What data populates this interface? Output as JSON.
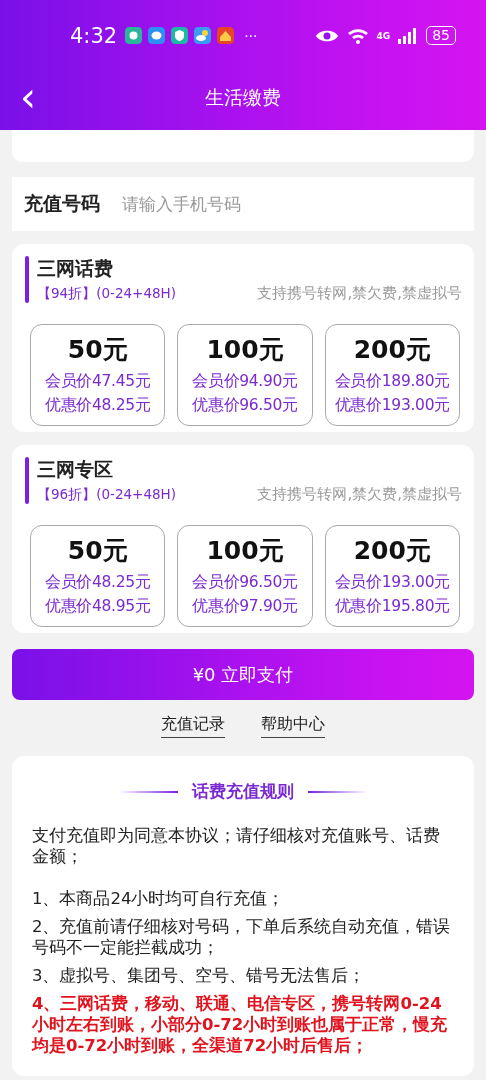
{
  "status_bar": {
    "time": "4:32",
    "more": "···",
    "network": "4G",
    "battery": "85"
  },
  "nav": {
    "back": "‹",
    "title": "生活缴费"
  },
  "phone": {
    "label": "充值号码",
    "placeholder": "请输入手机号码"
  },
  "plans": [
    {
      "title": "三网话费",
      "discount": "【94折】(0-24+48H)",
      "note": "支持携号转网,禁欠费,禁虚拟号",
      "options": [
        {
          "amount": "50元",
          "member": "会员价47.45元",
          "promo": "优惠价48.25元"
        },
        {
          "amount": "100元",
          "member": "会员价94.90元",
          "promo": "优惠价96.50元"
        },
        {
          "amount": "200元",
          "member": "会员价189.80元",
          "promo": "优惠价193.00元"
        }
      ]
    },
    {
      "title": "三网专区",
      "discount": "【96折】(0-24+48H)",
      "note": "支持携号转网,禁欠费,禁虚拟号",
      "options": [
        {
          "amount": "50元",
          "member": "会员价48.25元",
          "promo": "优惠价48.95元"
        },
        {
          "amount": "100元",
          "member": "会员价96.50元",
          "promo": "优惠价97.90元"
        },
        {
          "amount": "200元",
          "member": "会员价193.00元",
          "promo": "优惠价195.80元"
        }
      ]
    }
  ],
  "pay_button": "¥0 立即支付",
  "links": [
    "充值记录",
    "帮助中心"
  ],
  "rules": {
    "title": "话费充值规则",
    "intro": "支付充值即为同意本协议；请仔细核对充值账号、话费金额；",
    "items": [
      {
        "kind": "normal",
        "text": "1、本商品24小时均可自行充值；"
      },
      {
        "kind": "normal",
        "text": "2、充值前请仔细核对号码，下单后系统自动充值，错误号码不一定能拦截成功；"
      },
      {
        "kind": "normal",
        "text": "3、虚拟号、集团号、空号、错号无法售后；"
      },
      {
        "kind": "highlight",
        "text": "4、三网话费，移动、联通、电信专区，携号转网0-24小时左右到账，小部分0-72小时到账也属于正常，慢充均是0-72小时到账，全渠道72小时后售后；"
      }
    ]
  }
}
